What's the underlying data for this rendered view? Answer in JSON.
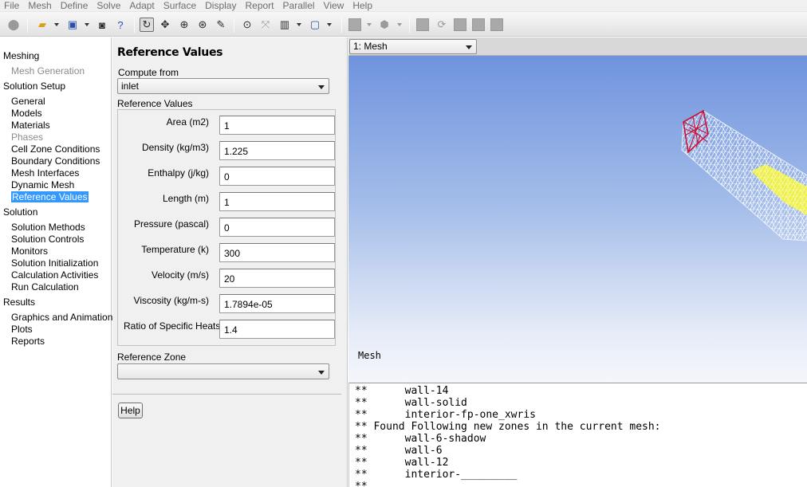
{
  "menu": [
    "File",
    "Mesh",
    "Define",
    "Solve",
    "Adapt",
    "Surface",
    "Display",
    "Report",
    "Parallel",
    "View",
    "Help"
  ],
  "toolbar": {
    "icons": [
      "app-icon",
      "open-icon",
      "save-icon",
      "snapshot-icon",
      "help-icon",
      "rotate-icon",
      "pan-icon",
      "zoom-in-icon",
      "zoom-box-icon",
      "probe-icon",
      "zoom-to-fit-icon",
      "axes-icon",
      "layout-icon",
      "window-icon",
      "solid-icon",
      "views-icon",
      "window-square-1-icon",
      "refresh-icon",
      "window-square-2-icon",
      "window-square-3-icon",
      "window-square-4-icon"
    ]
  },
  "nav": {
    "sections": [
      {
        "title": "Meshing",
        "items": [
          {
            "label": "Mesh Generation",
            "disabled": true
          }
        ]
      },
      {
        "title": "Solution Setup",
        "items": [
          {
            "label": "General"
          },
          {
            "label": "Models"
          },
          {
            "label": "Materials"
          },
          {
            "label": "Phases",
            "disabled": true
          },
          {
            "label": "Cell Zone Conditions"
          },
          {
            "label": "Boundary Conditions"
          },
          {
            "label": "Mesh Interfaces"
          },
          {
            "label": "Dynamic Mesh"
          },
          {
            "label": "Reference Values",
            "selected": true
          }
        ]
      },
      {
        "title": "Solution",
        "items": [
          {
            "label": "Solution Methods"
          },
          {
            "label": "Solution Controls"
          },
          {
            "label": "Monitors"
          },
          {
            "label": "Solution Initialization"
          },
          {
            "label": "Calculation Activities"
          },
          {
            "label": "Run Calculation"
          }
        ]
      },
      {
        "title": "Results",
        "items": [
          {
            "label": "Graphics and Animations"
          },
          {
            "label": "Plots"
          },
          {
            "label": "Reports"
          }
        ]
      }
    ]
  },
  "panel": {
    "title": "Reference Values",
    "compute_from_label": "Compute from",
    "compute_from_value": "inlet",
    "group_label": "Reference Values",
    "fields": [
      {
        "label": "Area (m2)",
        "value": "1"
      },
      {
        "label": "Density (kg/m3)",
        "value": "1.225"
      },
      {
        "label": "Enthalpy (j/kg)",
        "value": "0"
      },
      {
        "label": "Length (m)",
        "value": "1"
      },
      {
        "label": "Pressure (pascal)",
        "value": "0"
      },
      {
        "label": "Temperature (k)",
        "value": "300"
      },
      {
        "label": "Velocity (m/s)",
        "value": "20"
      },
      {
        "label": "Viscosity (kg/m-s)",
        "value": "1.7894e-05"
      },
      {
        "label": "Ratio of Specific Heats",
        "value": "1.4"
      }
    ],
    "reference_zone_label": "Reference Zone",
    "reference_zone_value": "",
    "help_label": "Help"
  },
  "graphics": {
    "window_select": "1: Mesh",
    "label": "Mesh",
    "colors": {
      "mesh_lines": "#ffffff",
      "inlet": "#cc1133",
      "highlight": "#f5f53a"
    }
  },
  "console": {
    "lines": [
      "**      wall-14",
      "**      wall-solid",
      "**      interior-fp-one_xwris",
      "** Found Following new zones in the current mesh:",
      "**      wall-6-shadow",
      "**      wall-6",
      "**      wall-12",
      "**      interior-_________",
      "**"
    ]
  }
}
